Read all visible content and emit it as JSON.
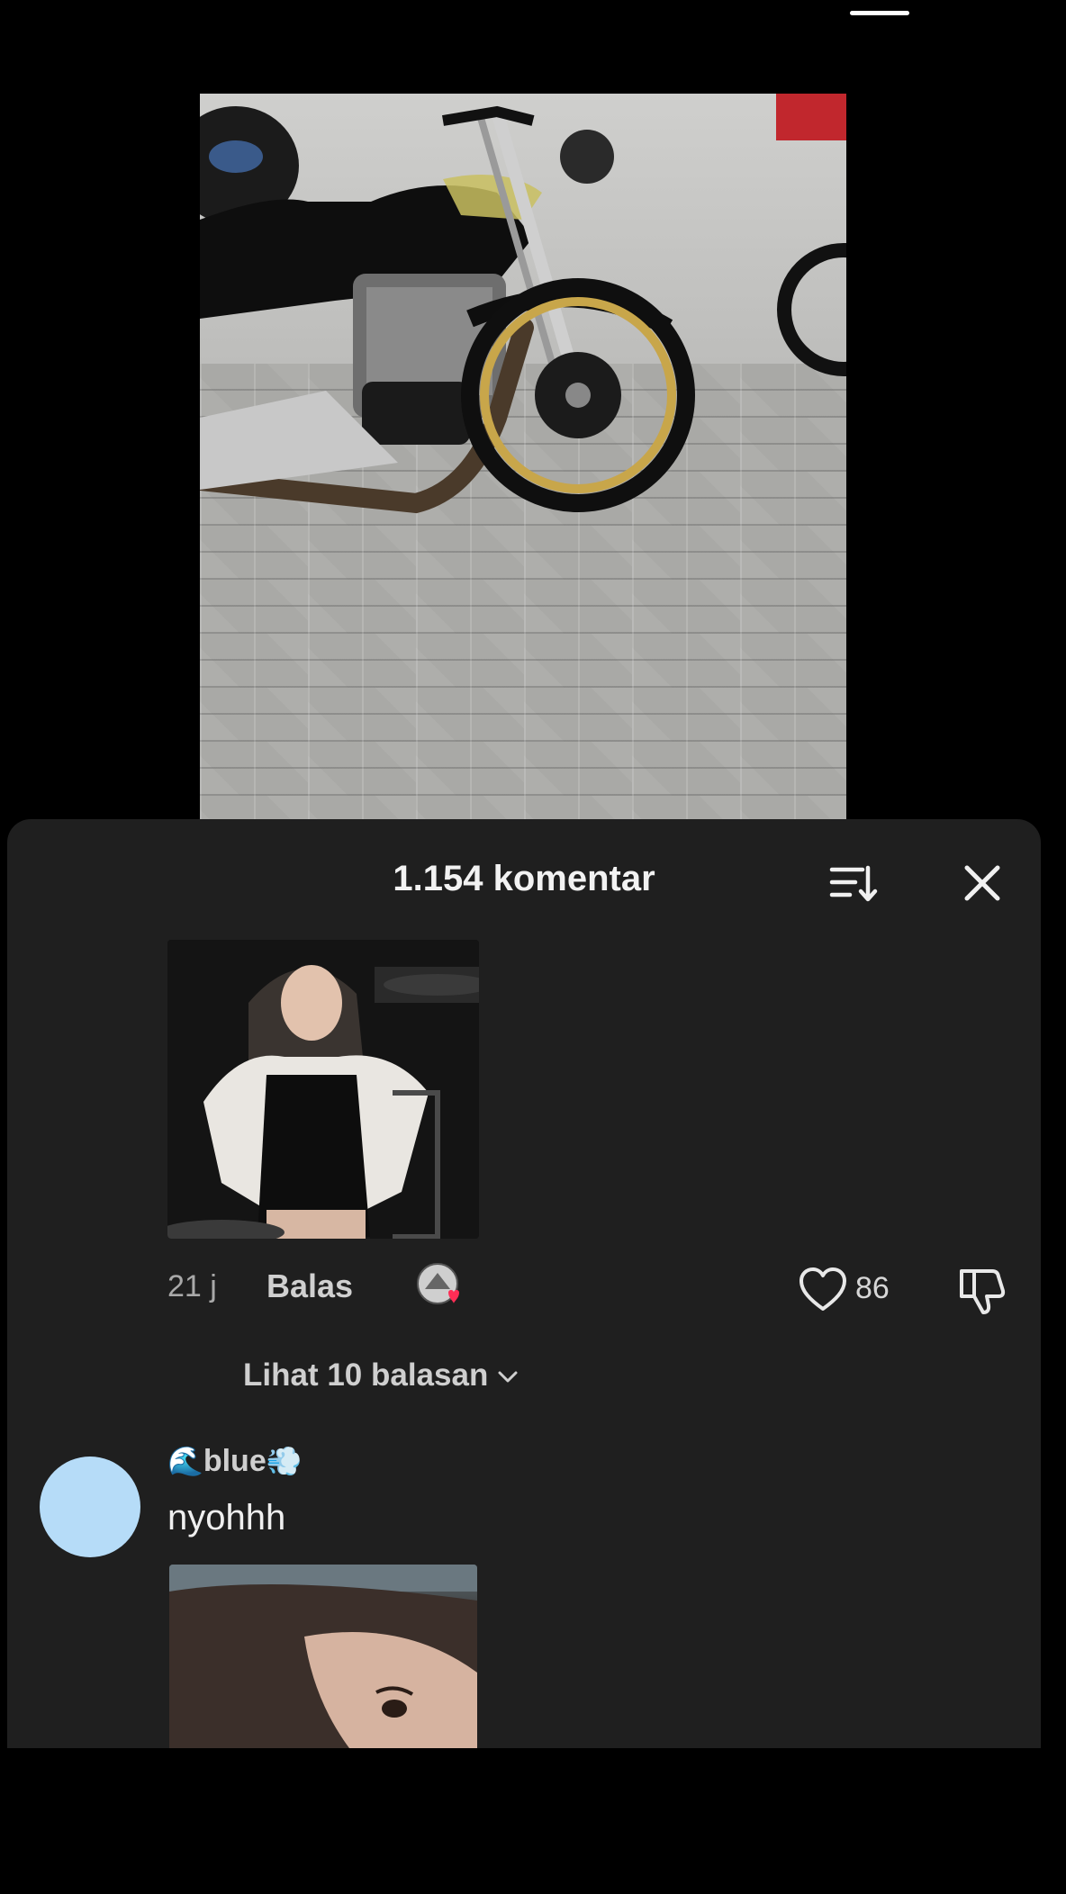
{
  "header": {
    "title": "1.154 komentar"
  },
  "comments": [
    {
      "time": "21 j",
      "reply_label": "Balas",
      "likes": "86",
      "view_replies": "Lihat 10 balasan"
    },
    {
      "username_emoji_left": "🌊",
      "username": "blue",
      "username_emoji_right": "💨",
      "text": "nyohhh"
    }
  ],
  "colors": {
    "sheet_bg": "#1f1f1f",
    "like_heart": "#ff2d55",
    "avatar_bg": "#b6dcf8"
  }
}
